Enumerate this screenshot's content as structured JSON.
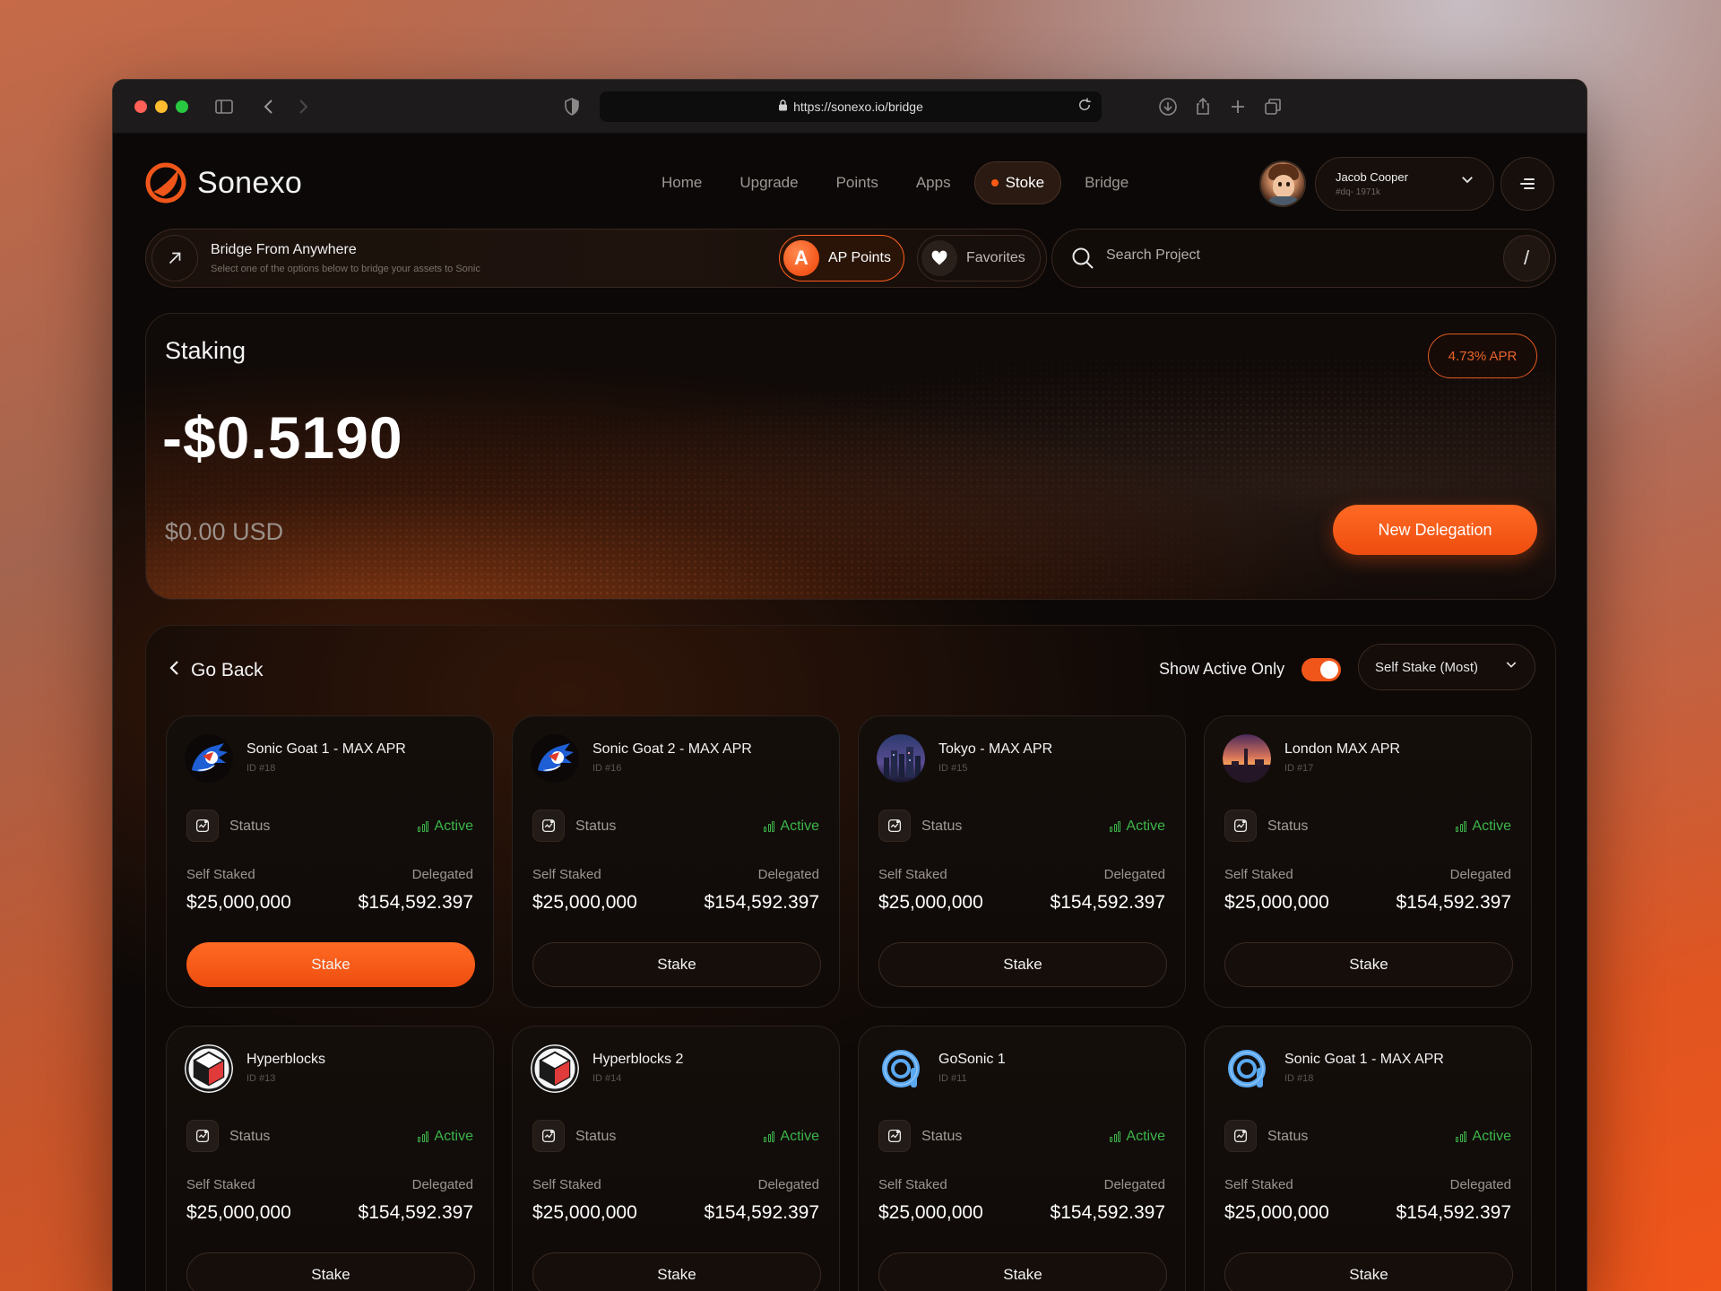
{
  "browser": {
    "url": "https://sonexo.io/bridge"
  },
  "brand": {
    "name": "Sonexo",
    "accent": "#f0561a"
  },
  "nav": {
    "items": [
      "Home",
      "Upgrade",
      "Points",
      "Apps",
      "Stoke",
      "Bridge"
    ],
    "active": "Stoke"
  },
  "user": {
    "name": "Jacob Cooper",
    "handle": "#dq- 1971k"
  },
  "bridge": {
    "title": "Bridge From Anywhere",
    "subtitle": "Select one of the options below to bridge your assets to Sonic",
    "ap_label": "AP Points",
    "ap_icon_letter": "A",
    "favorites_label": "Favorites"
  },
  "search": {
    "placeholder": "Search Project",
    "shortcut": "/"
  },
  "staking": {
    "title": "Staking",
    "value": "-$0.5190",
    "usd": "$0.00 USD",
    "apr": "4.73% APR",
    "new_delegation": "New Delegation"
  },
  "panel": {
    "back_label": "Go Back",
    "active_only_label": "Show Active Only",
    "active_only": true,
    "sort_value": "Self Stake (Most)"
  },
  "cards": [
    {
      "name": "Sonic Goat 1 - MAX APR",
      "id": "ID #18",
      "logo": "sonic",
      "status_label": "Status",
      "status": "Active",
      "self_label": "Self Staked",
      "self": "$25,000,000",
      "deleg_label": "Delegated",
      "deleg": "$154,592.397",
      "button": "Stake",
      "primary": true
    },
    {
      "name": "Sonic Goat 2 - MAX APR",
      "id": "ID #16",
      "logo": "sonic",
      "status_label": "Status",
      "status": "Active",
      "self_label": "Self Staked",
      "self": "$25,000,000",
      "deleg_label": "Delegated",
      "deleg": "$154,592.397",
      "button": "Stake",
      "primary": false
    },
    {
      "name": "Tokyo - MAX APR",
      "id": "ID #15",
      "logo": "city",
      "status_label": "Status",
      "status": "Active",
      "self_label": "Self Staked",
      "self": "$25,000,000",
      "deleg_label": "Delegated",
      "deleg": "$154,592.397",
      "button": "Stake",
      "primary": false
    },
    {
      "name": "London MAX APR",
      "id": "ID #17",
      "logo": "london",
      "status_label": "Status",
      "status": "Active",
      "self_label": "Self Staked",
      "self": "$25,000,000",
      "deleg_label": "Delegated",
      "deleg": "$154,592.397",
      "button": "Stake",
      "primary": false
    },
    {
      "name": "Hyperblocks",
      "id": "ID #13",
      "logo": "hyper",
      "status_label": "Status",
      "status": "Active",
      "self_label": "Self Staked",
      "self": "$25,000,000",
      "deleg_label": "Delegated",
      "deleg": "$154,592.397",
      "button": "Stake",
      "primary": false
    },
    {
      "name": "Hyperblocks 2",
      "id": "ID #14",
      "logo": "hyper",
      "status_label": "Status",
      "status": "Active",
      "self_label": "Self Staked",
      "self": "$25,000,000",
      "deleg_label": "Delegated",
      "deleg": "$154,592.397",
      "button": "Stake",
      "primary": false
    },
    {
      "name": "GoSonic 1",
      "id": "ID #11",
      "logo": "go",
      "status_label": "Status",
      "status": "Active",
      "self_label": "Self Staked",
      "self": "$25,000,000",
      "deleg_label": "Delegated",
      "deleg": "$154,592.397",
      "button": "Stake",
      "primary": false
    },
    {
      "name": "Sonic Goat 1 - MAX APR",
      "id": "ID #18",
      "logo": "go",
      "status_label": "Status",
      "status": "Active",
      "self_label": "Self Staked",
      "self": "$25,000,000",
      "deleg_label": "Delegated",
      "deleg": "$154,592.397",
      "button": "Stake",
      "primary": false
    }
  ]
}
